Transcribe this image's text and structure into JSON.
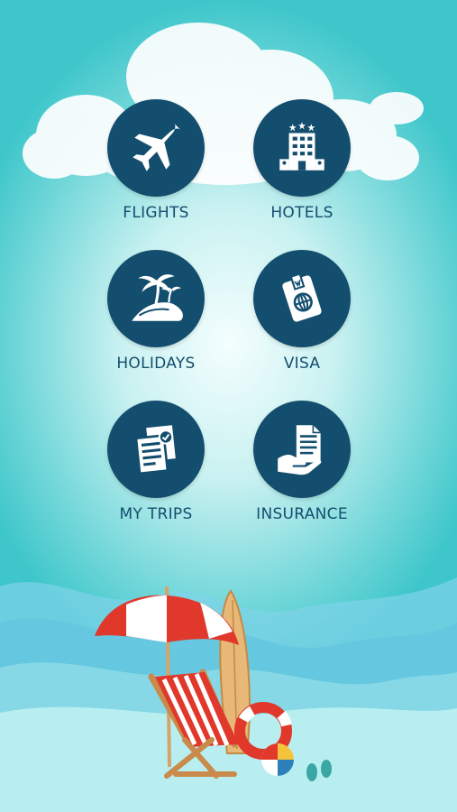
{
  "colors": {
    "accent": "#134e6f",
    "background_edge": "#3ec6ca",
    "background_center": "#f4fefe"
  },
  "menu": [
    {
      "label": "FLIGHTS",
      "icon": "airplane-icon"
    },
    {
      "label": "HOTELS",
      "icon": "hotel-building-icon"
    },
    {
      "label": "HOLIDAYS",
      "icon": "palm-island-icon"
    },
    {
      "label": "VISA",
      "icon": "passport-icon"
    },
    {
      "label": "MY TRIPS",
      "icon": "documents-check-icon"
    },
    {
      "label": "INSURANCE",
      "icon": "hand-document-icon"
    }
  ]
}
